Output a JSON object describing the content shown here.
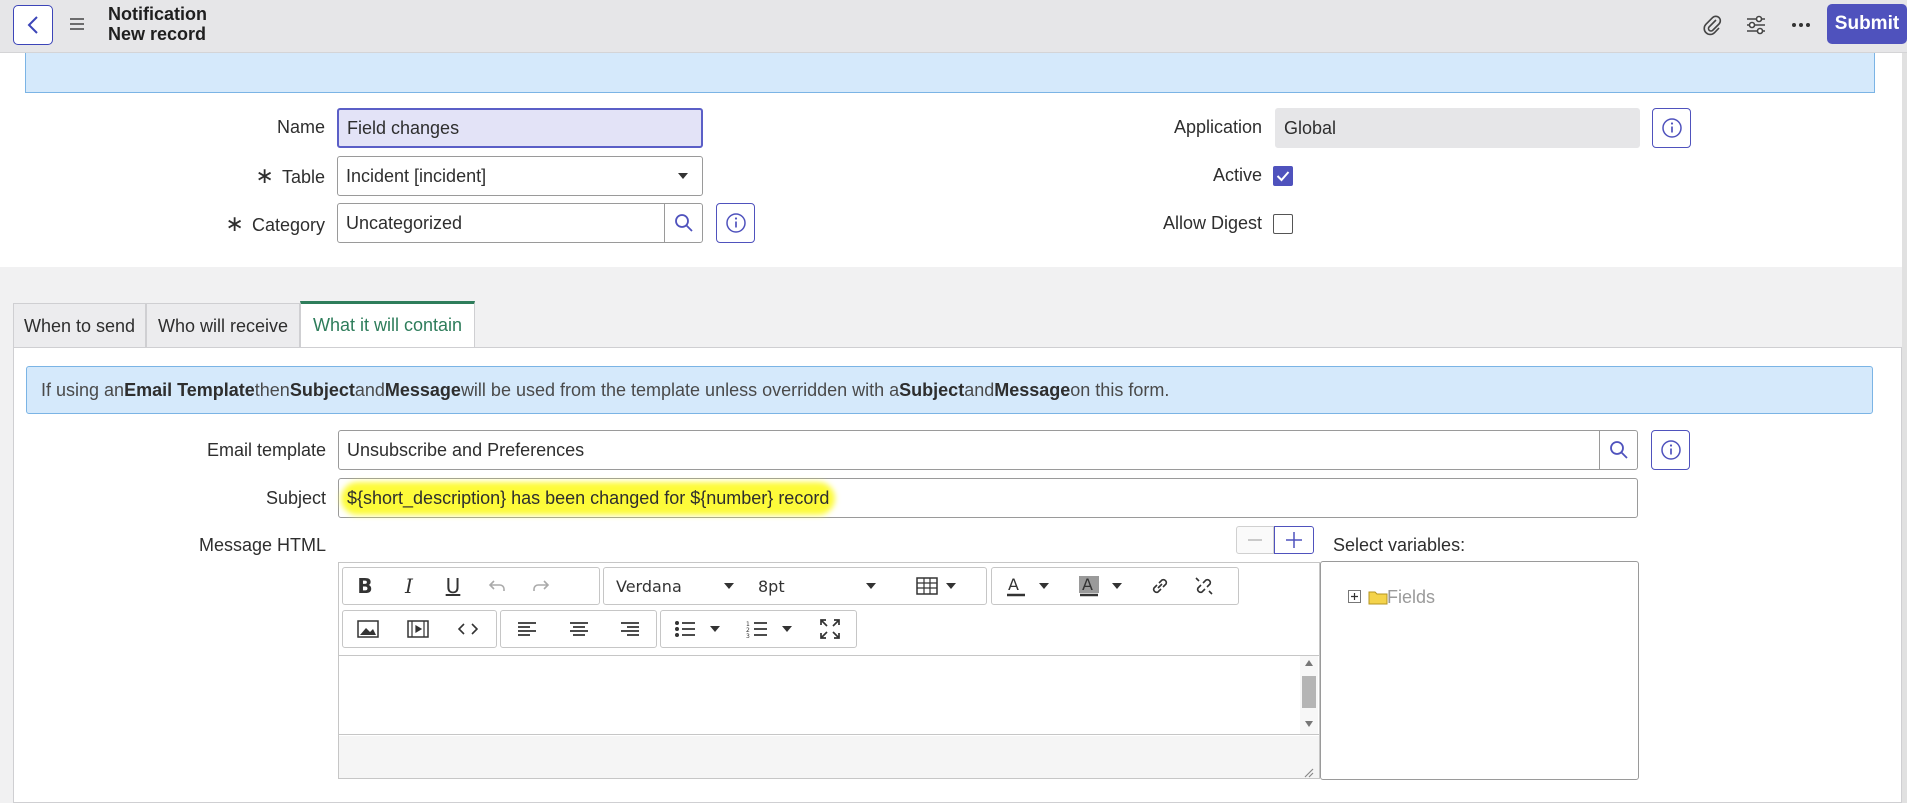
{
  "header": {
    "title": "Notification",
    "subtitle": "New record",
    "submit_label": "Submit",
    "icons": [
      "back-icon",
      "menu-icon",
      "paperclip-icon",
      "sliders-icon",
      "more-icon"
    ]
  },
  "form": {
    "name_label": "Name",
    "name_value": "Field changes",
    "table_label": "Table",
    "table_value": "Incident [incident]",
    "category_label": "Category",
    "category_value": "Uncategorized",
    "required_mark": "∗",
    "application_label": "Application",
    "application_value": "Global",
    "active_label": "Active",
    "active_checked": true,
    "allow_digest_label": "Allow Digest",
    "allow_digest_checked": false
  },
  "tabs": [
    {
      "label": "When to send",
      "active": false
    },
    {
      "label": "Who will receive",
      "active": false
    },
    {
      "label": "What it will contain",
      "active": true
    }
  ],
  "content": {
    "banner": {
      "p1": "If using an ",
      "b1": "Email Template",
      "p2": " then ",
      "b2": "Subject",
      "p3": " and ",
      "b3": "Message",
      "p4": " will be used from the template unless overridden with a ",
      "b4": "Subject",
      "p5": " and ",
      "b5": "Message",
      "p6": " on this form."
    },
    "email_template_label": "Email template",
    "email_template_value": "Unsubscribe and Preferences",
    "subject_label": "Subject",
    "subject_value": "${short_description} has been changed for ${number} record",
    "message_html_label": "Message HTML",
    "select_variables_label": "Select variables:",
    "variables_tree_root": "Fields"
  },
  "editor": {
    "font_family": "Verdana",
    "font_size": "8pt"
  },
  "colors": {
    "accent": "#4f52bd",
    "active_tab": "#2e7d5b",
    "banner_bg": "#d5e9fb",
    "highlight": "#fdfb3a"
  }
}
